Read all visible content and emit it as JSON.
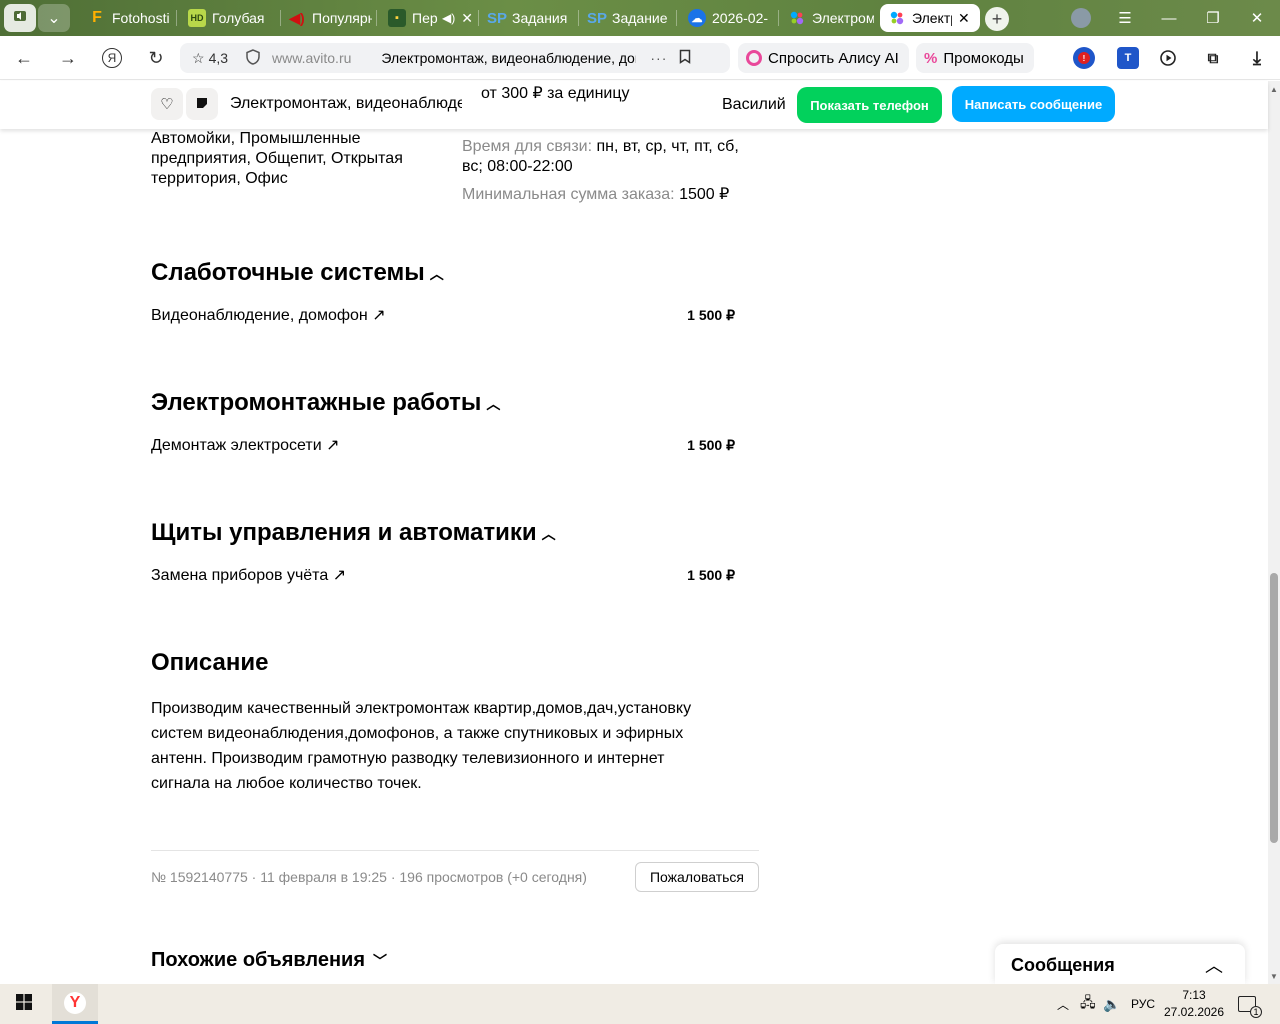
{
  "browser": {
    "tabs": [
      {
        "label": "Fotohosting",
        "icon": "F"
      },
      {
        "label": "Голубая",
        "icon": "HD"
      },
      {
        "label": "Популярные",
        "icon": "sound"
      },
      {
        "label": "Пер",
        "icon": "game"
      },
      {
        "label": "Задания",
        "icon": "SP"
      },
      {
        "label": "Задание",
        "icon": "SP"
      },
      {
        "label": "2026-02-",
        "icon": "cloud"
      },
      {
        "label": "Электромонтаж",
        "icon": "avito"
      },
      {
        "label": "Электр",
        "icon": "avito",
        "active": true
      }
    ],
    "address": {
      "rating": "4,3",
      "domain": "www.avito.ru",
      "page_title": "Электромонтаж, видеонаблюдение, домофоны"
    },
    "alice_label": "Спросить Алису AI",
    "promo_label": "Промокоды"
  },
  "sticky_header": {
    "title": "Электромонтаж, видеонаблюдение",
    "price": "от 300 ₽ за единицу",
    "seller": "Василий",
    "show_phone_label": "Показать телефон",
    "write_message_label": "Написать сообщение"
  },
  "details": {
    "facilities": "Автомойки, Промышленные предприятия, Общепит, Открытая территория, Офис",
    "contact_hours_label": "Время для связи:",
    "contact_hours_value": "пн, вт, ср, чт, пт, сб, вс; 08:00-22:00",
    "min_order_label": "Минимальная сумма заказа:",
    "min_order_value": "1500 ₽"
  },
  "sections": [
    {
      "title": "Слаботочные системы",
      "service": "Видеонаблюдение, домофон",
      "price": "1 500 ₽"
    },
    {
      "title": "Электромонтажные работы",
      "service": "Демонтаж электросети",
      "price": "1 500 ₽"
    },
    {
      "title": "Щиты управления и автоматики",
      "service": "Замена приборов учёта",
      "price": "1 500 ₽"
    }
  ],
  "description": {
    "title": "Описание",
    "lines": [
      "Производим качественный электромонтаж квартир,домов,дач,установку",
      "систем видеонаблюдения,домофонов, а также спутниковых и эфирных",
      "антенн. Производим грамотную разводку телевизионного и интернет",
      "сигнала на любое количество точек."
    ]
  },
  "meta": {
    "line": "№ 1592140775 · 11 февраля в 19:25 · 196 просмотров (+0 сегодня)",
    "complain_label": "Пожаловаться"
  },
  "similar_title": "Похожие объявления",
  "messages_label": "Сообщения",
  "taskbar": {
    "lang": "РУС",
    "time": "7:13",
    "date": "27.02.2026",
    "notif_count": "1"
  },
  "colors": {
    "green_button": "#02d15c",
    "blue_button": "#00aaff",
    "muted_text": "#8a8a8a",
    "alice_pink": "#e9489a"
  }
}
